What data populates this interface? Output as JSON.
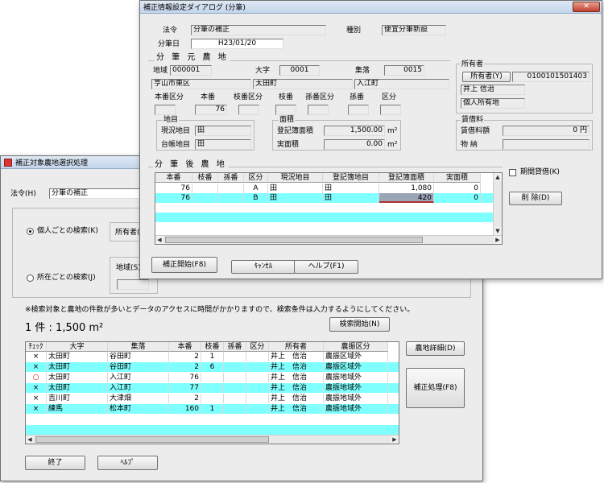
{
  "back": {
    "title": "補正対象農地選択処理",
    "law_label": "法令(H)",
    "law_value": "分筆の補正",
    "radio_individual": "個人ごとの検索(K)",
    "radio_location": "所在ごとの検索(J)",
    "owner_label": "所有者(",
    "region_label": "地域(S)",
    "note": "※検索対象と農地の件数が多いとデータのアクセスに時間がかかりますので、検索条件は入力するようにしてください。",
    "count": "1 件 : 1,500 m²",
    "search_start": "検索開始(N)",
    "columns": [
      "ﾁｪｯｸ",
      "大字",
      "集落",
      "本番",
      "枝番",
      "孫番",
      "区分",
      "所有者",
      "農振区分"
    ],
    "rows": [
      {
        "check": "×",
        "oaza": "太田町",
        "shuraku": "谷田町",
        "hon": "2",
        "eda": "1",
        "mago": "",
        "kubun": "",
        "owner": "井上　信治",
        "noshin": "農振区域外",
        "hl": false
      },
      {
        "check": "×",
        "oaza": "太田町",
        "shuraku": "谷田町",
        "hon": "2",
        "eda": "6",
        "mago": "",
        "kubun": "",
        "owner": "井上　信治",
        "noshin": "農振区域外",
        "hl": true
      },
      {
        "check": "○",
        "oaza": "太田町",
        "shuraku": "入江町",
        "hon": "76",
        "eda": "",
        "mago": "",
        "kubun": "",
        "owner": "井上　信治",
        "noshin": "農振地域外",
        "hl": false
      },
      {
        "check": "×",
        "oaza": "太田町",
        "shuraku": "入江町",
        "hon": "77",
        "eda": "",
        "mago": "",
        "kubun": "",
        "owner": "井上　信治",
        "noshin": "農振地域外",
        "hl": true
      },
      {
        "check": "×",
        "oaza": "吉川町",
        "shuraku": "大津畑",
        "hon": "2",
        "eda": "",
        "mago": "",
        "kubun": "",
        "owner": "井上　信治",
        "noshin": "農振地域外",
        "hl": false
      },
      {
        "check": "×",
        "oaza": "練馬",
        "shuraku": "松本町",
        "hon": "160",
        "eda": "1",
        "mago": "",
        "kubun": "",
        "owner": "井上　信治",
        "noshin": "農振地域外",
        "hl": true
      }
    ],
    "farm_detail": "農地詳細(D)",
    "correct_btn": "補正処理(F8)",
    "end_btn": "終了",
    "help_btn": "ﾍﾙﾌﾟ"
  },
  "front": {
    "title": "補正情報設定ダイアログ (分筆)",
    "law_label": "法令",
    "law_value": "分筆の補正",
    "kind_label": "種別",
    "kind_value": "便宜分筆新設",
    "date_label": "分筆日",
    "date_value": "H23/01/20",
    "origin_group": "分 筆 元 農 地",
    "area_label": "地域",
    "area_code": "000001",
    "oaza_label": "大字",
    "oaza_code": "0001",
    "shuraku_label": "集落",
    "shuraku_code": "0015",
    "area_name": "亨山市東区",
    "oaza_name": "太田町",
    "shuraku_name": "入江町",
    "sub_labels": [
      "本番区分",
      "本番",
      "枝番区分",
      "枝番",
      "孫番区分",
      "孫番",
      "区分"
    ],
    "hon_value": "76",
    "owner_group": "所有者",
    "owner_btn": "所有者(Y)",
    "owner_code": "0100101501403",
    "owner_name": "井上 信治",
    "owner_type": "個人所有地",
    "chimoku_group": "地目",
    "genkyo_label": "現況地目",
    "genkyo_value": "田",
    "daicho_label": "台帳地目",
    "daicho_value": "田",
    "menseki_group": "面積",
    "toki_label": "登記簿面積",
    "toki_value": "1,500.00",
    "jissoku_label": "実面積",
    "jissoku_value": "0.00",
    "unit": "m²",
    "rent_group": "賃借料",
    "rent_label": "賃借料額",
    "rent_value": "0 円",
    "butsuno_label": "物 納",
    "after_group": "分 筆 後 農 地",
    "columns": [
      "本番",
      "枝番",
      "孫番",
      "区分",
      "現況地目",
      "登記簿地目",
      "登記簿面積",
      "実面積"
    ],
    "rows": [
      {
        "hon": "76",
        "eda": "",
        "mago": "",
        "kubun": "A",
        "genkyo": "田",
        "toki": "田",
        "area": "1,080",
        "jitsu": "0",
        "hl": false
      },
      {
        "hon": "76",
        "eda": "",
        "mago": "",
        "kubun": "B",
        "genkyo": "田",
        "toki": "田",
        "area": "420",
        "jitsu": "0",
        "hl": true
      }
    ],
    "period_label": "期間貸借(K)",
    "delete_btn": "削 除(D)",
    "start_btn": "補正開始(F8)",
    "cancel_btn": "ｷｬﾝｾﾙ",
    "help_btn": "ヘルプ(F1)"
  }
}
